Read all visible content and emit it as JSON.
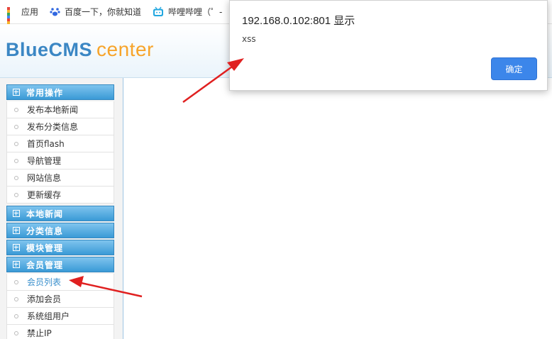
{
  "bookmarks": [
    {
      "label": "应用",
      "icon": "apps-grid-icon"
    },
    {
      "label": "百度一下，你就知道",
      "icon": "baidu-paw-icon"
    },
    {
      "label": "哔哩哔哩（゜-",
      "icon": "bilibili-tv-icon"
    }
  ],
  "header": {
    "logo_main": "BlueCMS",
    "logo_sub": "center"
  },
  "sidebar": {
    "groups": [
      {
        "label": "常用操作",
        "items": [
          "发布本地新闻",
          "发布分类信息",
          "首页flash",
          "导航管理",
          "网站信息",
          "更新缓存"
        ]
      },
      {
        "label": "本地新闻",
        "items": []
      },
      {
        "label": "分类信息",
        "items": []
      },
      {
        "label": "模块管理",
        "items": []
      },
      {
        "label": "会员管理",
        "items": [
          "会员列表",
          "添加会员",
          "系统组用户",
          "禁止IP"
        ]
      }
    ],
    "active_item": "会员列表"
  },
  "dialog": {
    "title": "192.168.0.102:801 显示",
    "message": "xss",
    "ok_label": "确定"
  },
  "colors": {
    "menu_head": "#3a9ad6",
    "logo_blue": "#3b87c4",
    "logo_orange": "#f7a42a",
    "button_blue": "#3c86ea",
    "arrow_red": "#e02020"
  }
}
